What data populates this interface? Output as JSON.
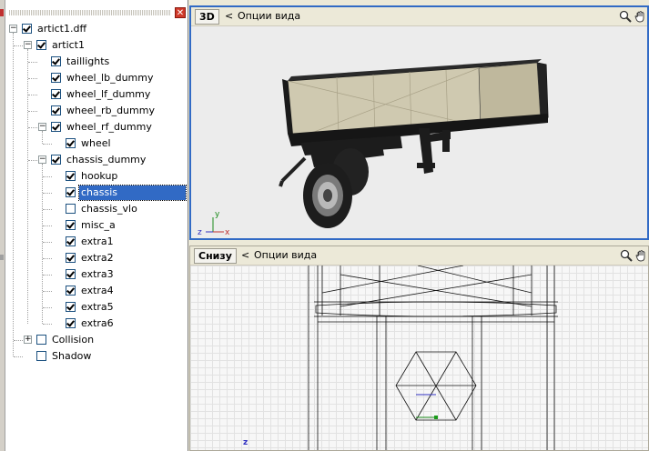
{
  "tree": {
    "close_glyph": "✕",
    "items": [
      {
        "label": "artict1.dff",
        "checked": true
      },
      {
        "label": "artict1",
        "checked": true
      },
      {
        "label": "taillights",
        "checked": true
      },
      {
        "label": "wheel_lb_dummy",
        "checked": true
      },
      {
        "label": "wheel_lf_dummy",
        "checked": true
      },
      {
        "label": "wheel_rb_dummy",
        "checked": true
      },
      {
        "label": "wheel_rf_dummy",
        "checked": true
      },
      {
        "label": "wheel",
        "checked": true
      },
      {
        "label": "chassis_dummy",
        "checked": true
      },
      {
        "label": "hookup",
        "checked": true
      },
      {
        "label": "chassis",
        "checked": true,
        "selected": true
      },
      {
        "label": "chassis_vlo",
        "checked": false
      },
      {
        "label": "misc_a",
        "checked": true
      },
      {
        "label": "extra1",
        "checked": true
      },
      {
        "label": "extra2",
        "checked": true
      },
      {
        "label": "extra3",
        "checked": true
      },
      {
        "label": "extra4",
        "checked": true
      },
      {
        "label": "extra5",
        "checked": true
      },
      {
        "label": "extra6",
        "checked": true
      },
      {
        "label": "Collision",
        "checked": false
      },
      {
        "label": "Shadow",
        "checked": false
      }
    ]
  },
  "viewport_3d": {
    "mode": "3D",
    "arrow": "<",
    "options": "Опции вида",
    "axis": {
      "y": "y",
      "z": "z",
      "x": "x"
    },
    "icons": [
      "zoom-icon",
      "hand-icon"
    ]
  },
  "viewport_bottom": {
    "mode": "Снизу",
    "arrow": "<",
    "options": "Опции вида",
    "axis": {
      "z": "z"
    },
    "icons": [
      "zoom-icon",
      "hand-icon"
    ]
  },
  "colors": {
    "selection": "#316ac5",
    "active_border": "#316ac5",
    "panel_bg": "#ece9d8"
  }
}
